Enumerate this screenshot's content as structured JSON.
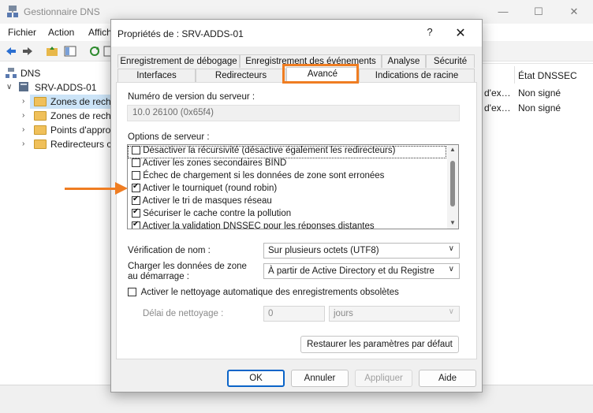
{
  "app": {
    "title": "Gestionnaire DNS",
    "window_controls": [
      "—",
      "☐",
      "✕"
    ]
  },
  "menu": [
    "Fichier",
    "Action",
    "Affich"
  ],
  "tree": {
    "root": "DNS",
    "server": "SRV-ADDS-01",
    "items": [
      "Zones de reche",
      "Zones de reche",
      "Points d'appro",
      "Redirecteurs co"
    ]
  },
  "right_pane": {
    "column_header": "État DNSSEC",
    "rows": [
      {
        "partial": "d'ex…",
        "dnssec": "Non signé"
      },
      {
        "partial": "d'ex…",
        "dnssec": "Non signé"
      }
    ]
  },
  "dialog": {
    "title": "Propriétés de : SRV-ADDS-01",
    "help": "?",
    "close": "✕",
    "tabs_row1": [
      "Enregistrement de débogage",
      "Enregistrement des événements",
      "Analyse",
      "Sécurité"
    ],
    "tabs_row2": [
      "Interfaces",
      "Redirecteurs",
      "Avancé",
      "Indications de racine"
    ],
    "active_tab": "Avancé",
    "version_label": "Numéro de version du serveur :",
    "version_value": "10.0 26100 (0x65f4)",
    "options_label": "Options de serveur :",
    "options": [
      {
        "label": "Désactiver la récursivité (désactive également les redirecteurs)",
        "checked": false
      },
      {
        "label": "Activer les zones secondaires BIND",
        "checked": false
      },
      {
        "label": "Échec de chargement si les données de zone sont erronées",
        "checked": false
      },
      {
        "label": "Activer le tourniquet (round robin)",
        "checked": true
      },
      {
        "label": "Activer le tri de masques réseau",
        "checked": true
      },
      {
        "label": "Sécuriser le cache contre la pollution",
        "checked": true
      },
      {
        "label": "Activer la validation DNSSEC pour les réponses distantes",
        "checked": true
      }
    ],
    "name_check_label": "Vérification de nom :",
    "name_check_value": "Sur plusieurs octets (UTF8)",
    "load_zone_label_1": "Charger les données de zone",
    "load_zone_label_2": "au démarrage :",
    "load_zone_value": "À partir de Active Directory et du Registre",
    "scavenging_label": "Activer le nettoyage automatique des enregistrements obsolètes",
    "scavenging_checked": false,
    "scavenging_delay_label": "Délai de nettoyage :",
    "scavenging_delay_value": "0",
    "scavenging_unit": "jours",
    "restore_defaults": "Restaurer les paramètres par défaut",
    "buttons": {
      "ok": "OK",
      "cancel": "Annuler",
      "apply": "Appliquer",
      "help": "Aide"
    }
  },
  "colors": {
    "highlight": "#ef7d22",
    "primary_button_border": "#0a64c8"
  }
}
